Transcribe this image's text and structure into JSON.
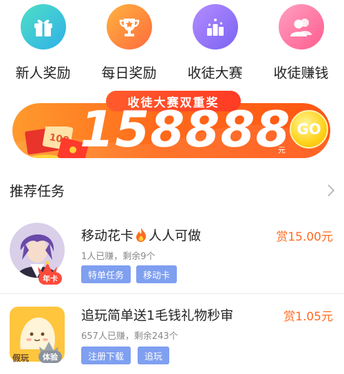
{
  "icons": [
    {
      "label": "新人奖励",
      "icon": "gift-icon",
      "color_from": "#4fdfc6",
      "color_to": "#2fb0e8"
    },
    {
      "label": "每日奖励",
      "icon": "trophy-icon",
      "color_from": "#ffb340",
      "color_to": "#ff6b3d"
    },
    {
      "label": "收徒大赛",
      "icon": "podium-icon",
      "color_from": "#b48cff",
      "color_to": "#7a63f2"
    },
    {
      "label": "收徒赚钱",
      "icon": "users-icon",
      "color_from": "#ff9fc0",
      "color_to": "#ff5d8f"
    }
  ],
  "banner": {
    "tab_label": "收徒大赛双重奖",
    "amount": "158888",
    "unit": "元",
    "go_label": "GO",
    "envelope_text": "100"
  },
  "section": {
    "title": "推荐任务"
  },
  "tasks": [
    {
      "title_before": "移动花卡",
      "title_after": "人人可做",
      "title_icon": "fire-icon",
      "meta": "1人已赚，剩余9个",
      "reward": "赏15.00元",
      "tags": [
        "特单任务",
        "移动卡"
      ],
      "badge": "年卡"
    },
    {
      "title": "追玩简单送1毛钱礼物秒审",
      "meta": "657人已赚，剩余243个",
      "reward": "赏1.05元",
      "tags": [
        "注册下载",
        "追玩"
      ],
      "badge": "体验",
      "logo_text": "假玩"
    }
  ],
  "colors": {
    "accent_orange": "#ff6a1f",
    "tag_blue": "#7f9ff0"
  }
}
